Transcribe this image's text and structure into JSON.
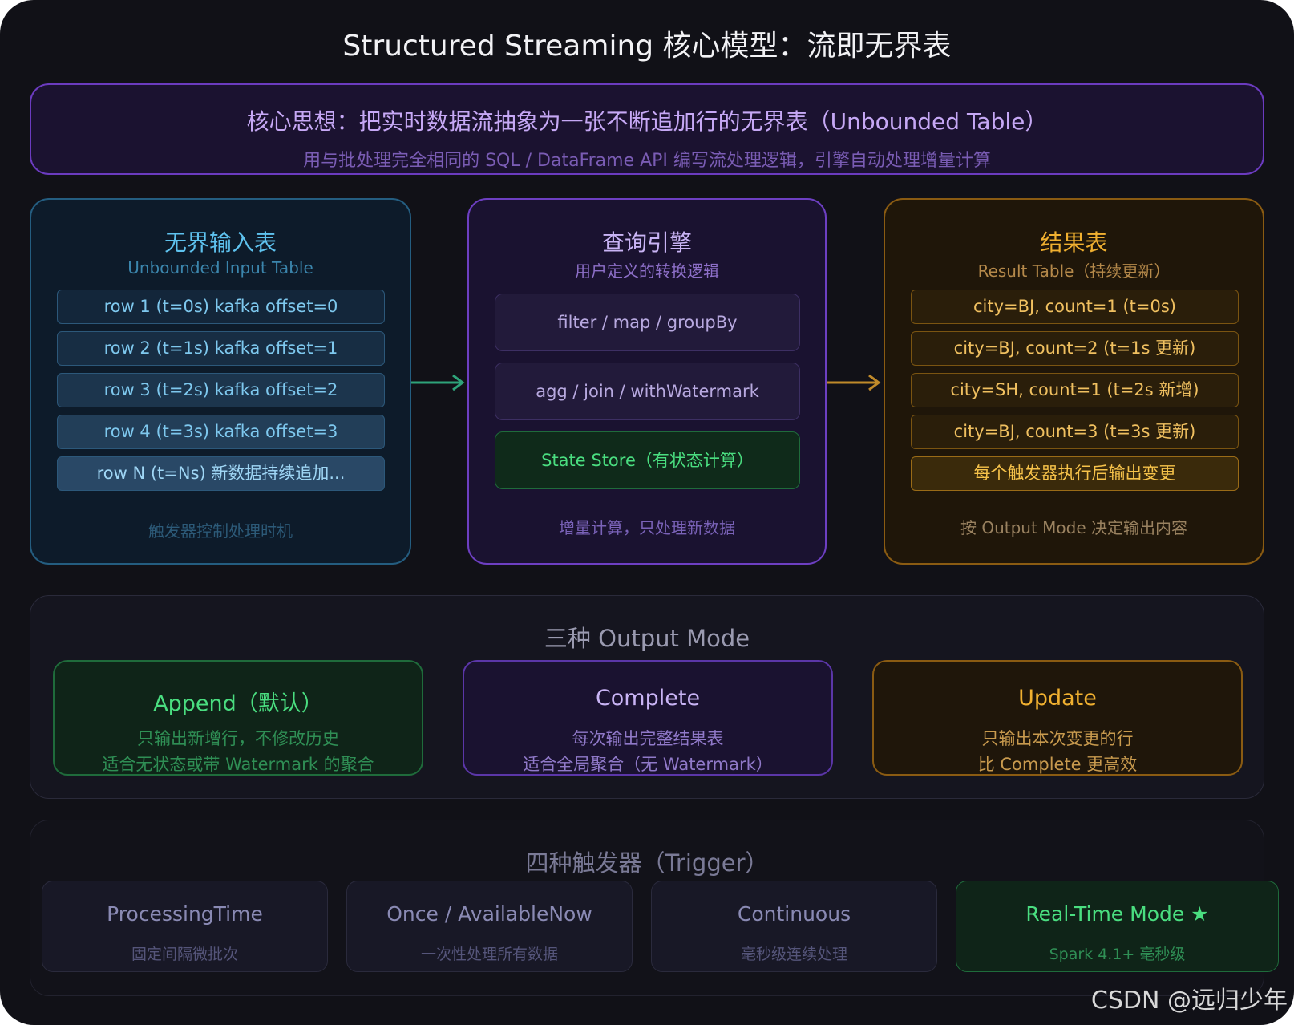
{
  "title": "Structured Streaming 核心模型：流即无界表",
  "banner": {
    "main": "核心思想：把实时数据流抽象为一张不断追加行的无界表（Unbounded Table）",
    "sub": "用与批处理完全相同的 SQL / DataFrame API 编写流处理逻辑，引擎自动处理增量计算"
  },
  "input_panel": {
    "title": "无界输入表",
    "subtitle": "Unbounded Input Table",
    "rows": [
      "row 1 (t=0s) kafka offset=0",
      "row 2 (t=1s) kafka offset=1",
      "row 3 (t=2s) kafka offset=2",
      "row 4 (t=3s) kafka offset=3",
      "row N (t=Ns) 新数据持续追加..."
    ],
    "footer": "触发器控制处理时机"
  },
  "engine_panel": {
    "title": "查询引擎",
    "subtitle": "用户定义的转换逻辑",
    "boxes": [
      "filter / map / groupBy",
      "agg / join / withWatermark",
      "State Store（有状态计算）"
    ],
    "footer": "增量计算，只处理新数据"
  },
  "result_panel": {
    "title": "结果表",
    "subtitle": "Result Table（持续更新）",
    "rows": [
      "city=BJ, count=1 (t=0s)",
      "city=BJ, count=2 (t=1s 更新)",
      "city=SH, count=1 (t=2s 新增)",
      "city=BJ, count=3 (t=3s 更新)",
      "每个触发器执行后输出变更"
    ],
    "footer": "按 Output Mode 决定输出内容"
  },
  "output_modes": {
    "title": "三种 Output Mode",
    "modes": [
      {
        "name": "Append（默认）",
        "line1": "只输出新增行，不修改历史",
        "line2": "适合无状态或带 Watermark 的聚合"
      },
      {
        "name": "Complete",
        "line1": "每次输出完整结果表",
        "line2": "适合全局聚合（无 Watermark）"
      },
      {
        "name": "Update",
        "line1": "只输出本次变更的行",
        "line2": "比 Complete 更高效"
      }
    ]
  },
  "triggers": {
    "title": "四种触发器（Trigger）",
    "items": [
      {
        "name": "ProcessingTime",
        "desc": "固定间隔微批次"
      },
      {
        "name": "Once / AvailableNow",
        "desc": "一次性处理所有数据"
      },
      {
        "name": "Continuous",
        "desc": "毫秒级连续处理"
      },
      {
        "name": "Real-Time Mode ★",
        "desc": "Spark 4.1+ 毫秒级"
      }
    ]
  },
  "watermark_text": "CSDN @远归少年",
  "colors": {
    "input_accent": "#5ec2ee",
    "engine_accent": "#b07cf0",
    "result_accent": "#f0b030",
    "green_accent": "#4ade80"
  }
}
